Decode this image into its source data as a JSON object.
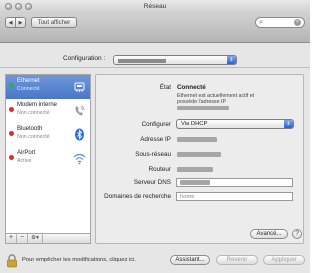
{
  "window": {
    "title": "Réseau"
  },
  "toolbar": {
    "show_all_label": "Tout afficher",
    "back_label": "◀",
    "forward_label": "▶"
  },
  "configuration": {
    "label": "Configuration :"
  },
  "sidebar": {
    "services": [
      {
        "name": "Ethernet",
        "status": "Connecté",
        "dot_color": "#2fb13c",
        "icon": "ethernet-icon"
      },
      {
        "name": "Modem interne",
        "status": "Non connecté",
        "dot_color": "#d9302c",
        "icon": "phone-icon"
      },
      {
        "name": "Bluetooth",
        "status": "Non connecté",
        "dot_color": "#d9302c",
        "icon": "bluetooth-icon"
      },
      {
        "name": "AirPort",
        "status": "Active",
        "dot_color": "#d9302c",
        "icon": "wifi-icon"
      }
    ],
    "add_label": "+",
    "remove_label": "−",
    "action_label": "⚙▾"
  },
  "detail": {
    "state_label": "État",
    "state_value": "Connecté",
    "state_desc_1": "Ethernet est actuellement actif et",
    "state_desc_2": "possède l'adresse IP",
    "configure_label": "Configurer",
    "configure_value": "Via DHCP",
    "ip_label": "Adresse IP",
    "subnet_label": "Sous-réseau",
    "router_label": "Routeur",
    "dns_label": "Serveur DNS",
    "search_domains_label": "Domaines de recherche",
    "search_domains_placeholder": "home",
    "advanced_label": "Avancé...",
    "help_label": "?"
  },
  "footer": {
    "lock_text": "Pour empêcher les modifications, cliquez ici.",
    "assistant_label": "Assistant...",
    "revert_label": "Revenir",
    "apply_label": "Appliquer"
  },
  "colors": {
    "selection": "#4a77c6",
    "connected": "#2fb13c",
    "disconnected": "#d9302c"
  }
}
